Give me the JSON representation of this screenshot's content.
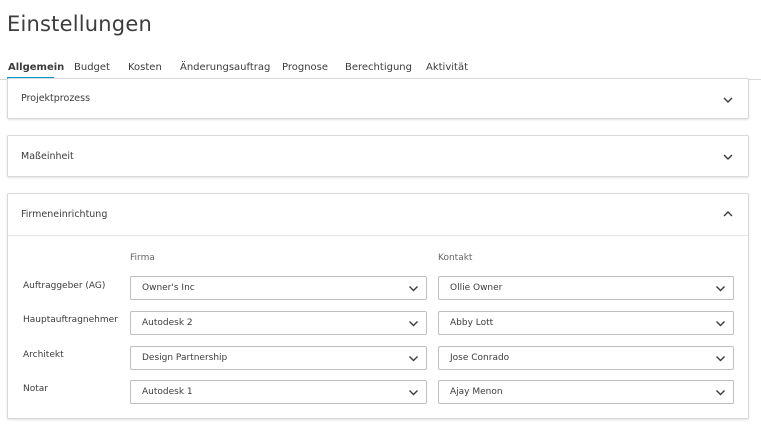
{
  "page": {
    "title": "Einstellungen"
  },
  "tabs": [
    {
      "label": "Allgemein"
    },
    {
      "label": "Budget"
    },
    {
      "label": "Kosten"
    },
    {
      "label": "Änderungsauftrag"
    },
    {
      "label": "Prognose"
    },
    {
      "label": "Berechtigung"
    },
    {
      "label": "Aktivität"
    }
  ],
  "panels": {
    "projektprozess": {
      "title": "Projektprozess",
      "expanded": false
    },
    "masseinheit": {
      "title": "Maßeinheit",
      "expanded": false
    },
    "firmeneinrichtung": {
      "title": "Firmeneinrichtung",
      "expanded": true,
      "columns": {
        "firma": "Firma",
        "kontakt": "Kontakt"
      },
      "rows": [
        {
          "label": "Auftraggeber (AG)",
          "firma": "Owner's Inc",
          "kontakt": "Ollie Owner"
        },
        {
          "label": "Hauptauftragnehmer",
          "firma": "Autodesk 2",
          "kontakt": "Abby Lott"
        },
        {
          "label": "Architekt",
          "firma": "Design Partnership",
          "kontakt": "Jose Conrado"
        },
        {
          "label": "Notar",
          "firma": "Autodesk 1",
          "kontakt": "Ajay Menon"
        }
      ]
    }
  },
  "colors": {
    "accent": "#0696d7",
    "border": "#d9d9d9",
    "text": "#3c3c3c"
  }
}
